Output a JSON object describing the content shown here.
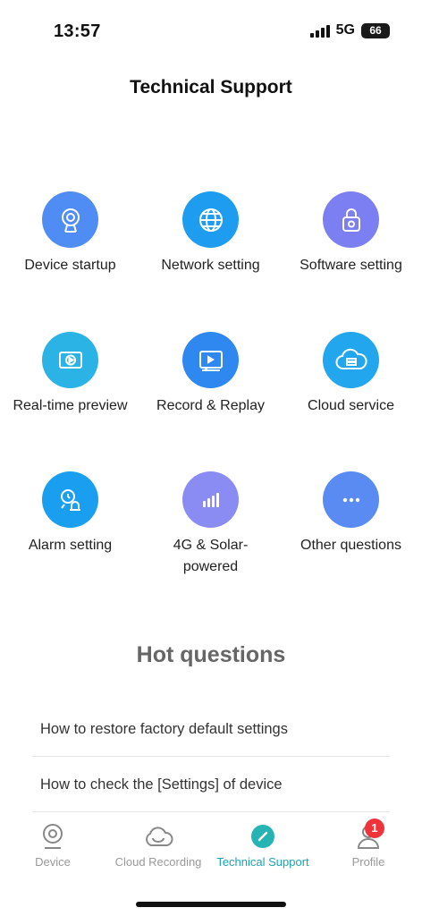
{
  "status_bar": {
    "time": "13:57",
    "network": "5G",
    "battery": "66"
  },
  "header": {
    "title": "Technical Support"
  },
  "categories": [
    {
      "label": "Device startup",
      "icon": "camera-icon",
      "color": "#4f8df5"
    },
    {
      "label": "Network setting",
      "icon": "globe-icon",
      "color": "#1e9cf0"
    },
    {
      "label": "Software setting",
      "icon": "lock-icon",
      "color": "#7c7ff2"
    },
    {
      "label": "Real-time preview",
      "icon": "video-play-icon",
      "color": "#2bb3e6"
    },
    {
      "label": "Record & Replay",
      "icon": "replay-monitor-icon",
      "color": "#2f87f0"
    },
    {
      "label": "Cloud service",
      "icon": "cloud-server-icon",
      "color": "#22a7ee"
    },
    {
      "label": "Alarm setting",
      "icon": "alarm-icon",
      "color": "#1a9ff0"
    },
    {
      "label": "4G & Solar-powered",
      "icon": "signal-bars-icon",
      "color": "#8a8cf3"
    },
    {
      "label": "Other questions",
      "icon": "more-dots-icon",
      "color": "#5a8bf2"
    }
  ],
  "hot_questions": {
    "title": "Hot questions",
    "items": [
      "How to restore factory default settings",
      "How to check the [Settings] of device"
    ]
  },
  "tab_bar": {
    "items": [
      {
        "label": "Device",
        "icon": "device-camera-icon"
      },
      {
        "label": "Cloud Recording",
        "icon": "cloud-icon"
      },
      {
        "label": "Technical Support",
        "icon": "support-icon",
        "active": true
      },
      {
        "label": "Profile",
        "icon": "profile-icon",
        "badge": "1"
      }
    ],
    "active_color": "#1aa3b5"
  }
}
